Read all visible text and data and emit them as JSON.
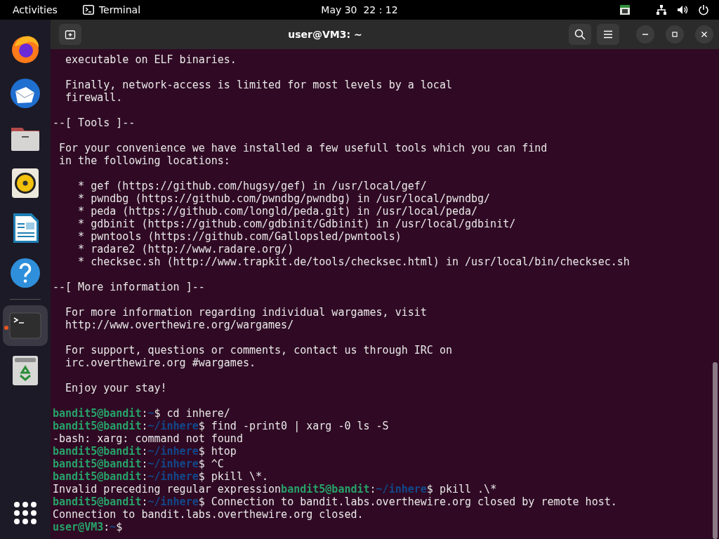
{
  "top_bar": {
    "activities": "Activities",
    "app_name": "Terminal",
    "clock": "May 30  22 : 12"
  },
  "dock": [
    {
      "kind": "browser",
      "running": false
    },
    {
      "kind": "mail",
      "running": false
    },
    {
      "kind": "files",
      "running": false
    },
    {
      "kind": "music",
      "running": false
    },
    {
      "kind": "writer",
      "running": false
    },
    {
      "kind": "help",
      "running": false
    },
    {
      "kind": "terminal",
      "running": true
    },
    {
      "kind": "trash",
      "running": false
    }
  ],
  "window": {
    "title": "user@VM3: ~"
  },
  "terminal": {
    "blocks": [
      [
        [
          {
            "kind": "text",
            "text": "  executable on ELF binaries."
          }
        ]
      ],
      [
        [
          {
            "kind": "text",
            "text": "  Finally, network-access is limited for most levels by a local"
          }
        ],
        [
          {
            "kind": "text",
            "text": "  firewall."
          }
        ]
      ],
      [
        [
          {
            "kind": "text",
            "text": "--[ Tools ]--"
          }
        ]
      ],
      [
        [
          {
            "kind": "text",
            "text": " For your convenience we have installed a few usefull tools which you can find"
          }
        ],
        [
          {
            "kind": "text",
            "text": " in the following locations:"
          }
        ]
      ],
      [
        [
          {
            "kind": "text",
            "text": "    * gef (https://github.com/hugsy/gef) in /usr/local/gef/"
          }
        ],
        [
          {
            "kind": "text",
            "text": "    * pwndbg (https://github.com/pwndbg/pwndbg) in /usr/local/pwndbg/"
          }
        ],
        [
          {
            "kind": "text",
            "text": "    * peda (https://github.com/longld/peda.git) in /usr/local/peda/"
          }
        ],
        [
          {
            "kind": "text",
            "text": "    * gdbinit (https://github.com/gdbinit/Gdbinit) in /usr/local/gdbinit/"
          }
        ],
        [
          {
            "kind": "text",
            "text": "    * pwntools (https://github.com/Gallopsled/pwntools)"
          }
        ],
        [
          {
            "kind": "text",
            "text": "    * radare2 (http://www.radare.org/)"
          }
        ],
        [
          {
            "kind": "text",
            "text": "    * checksec.sh (http://www.trapkit.de/tools/checksec.html) in /usr/local/bin/checksec.sh"
          }
        ]
      ],
      [
        [
          {
            "kind": "text",
            "text": "--[ More information ]--"
          }
        ]
      ],
      [
        [
          {
            "kind": "text",
            "text": "  For more information regarding individual wargames, visit"
          }
        ],
        [
          {
            "kind": "text",
            "text": "  http://www.overthewire.org/wargames/"
          }
        ]
      ],
      [
        [
          {
            "kind": "text",
            "text": "  For support, questions or comments, contact us through IRC on"
          }
        ],
        [
          {
            "kind": "text",
            "text": "  irc.overthewire.org #wargames."
          }
        ]
      ],
      [
        [
          {
            "kind": "text",
            "text": "  Enjoy your stay!"
          }
        ]
      ],
      [
        [
          {
            "kind": "user",
            "text": "bandit5@bandit"
          },
          {
            "kind": "text",
            "text": ":"
          },
          {
            "kind": "path",
            "text": "~"
          },
          {
            "kind": "text",
            "text": "$ cd inhere/"
          }
        ],
        [
          {
            "kind": "user",
            "text": "bandit5@bandit"
          },
          {
            "kind": "text",
            "text": ":"
          },
          {
            "kind": "path",
            "text": "~/inhere"
          },
          {
            "kind": "text",
            "text": "$ find -print0 | xarg -0 ls -S"
          }
        ],
        [
          {
            "kind": "text",
            "text": "-bash: xarg: command not found"
          }
        ],
        [
          {
            "kind": "user",
            "text": "bandit5@bandit"
          },
          {
            "kind": "text",
            "text": ":"
          },
          {
            "kind": "path",
            "text": "~/inhere"
          },
          {
            "kind": "text",
            "text": "$ htop"
          }
        ],
        [
          {
            "kind": "user",
            "text": "bandit5@bandit"
          },
          {
            "kind": "text",
            "text": ":"
          },
          {
            "kind": "path",
            "text": "~/inhere"
          },
          {
            "kind": "text",
            "text": "$ ^C"
          }
        ],
        [
          {
            "kind": "user",
            "text": "bandit5@bandit"
          },
          {
            "kind": "text",
            "text": ":"
          },
          {
            "kind": "path",
            "text": "~/inhere"
          },
          {
            "kind": "text",
            "text": "$ pkill \\*."
          }
        ],
        [
          {
            "kind": "text",
            "text": "Invalid preceding regular expression"
          },
          {
            "kind": "user",
            "text": "bandit5@bandit"
          },
          {
            "kind": "text",
            "text": ":"
          },
          {
            "kind": "path",
            "text": "~/inhere"
          },
          {
            "kind": "text",
            "text": "$ pkill .\\*"
          }
        ],
        [
          {
            "kind": "user",
            "text": "bandit5@bandit"
          },
          {
            "kind": "text",
            "text": ":"
          },
          {
            "kind": "path",
            "text": "~/inhere"
          },
          {
            "kind": "text",
            "text": "$ Connection to bandit.labs.overthewire.org closed by remote host."
          }
        ],
        [
          {
            "kind": "text",
            "text": "Connection to bandit.labs.overthewire.org closed."
          }
        ],
        [
          {
            "kind": "user",
            "text": "user@VM3"
          },
          {
            "kind": "text",
            "text": ":"
          },
          {
            "kind": "path",
            "text": "~"
          },
          {
            "kind": "text",
            "text": "$"
          }
        ]
      ]
    ]
  }
}
